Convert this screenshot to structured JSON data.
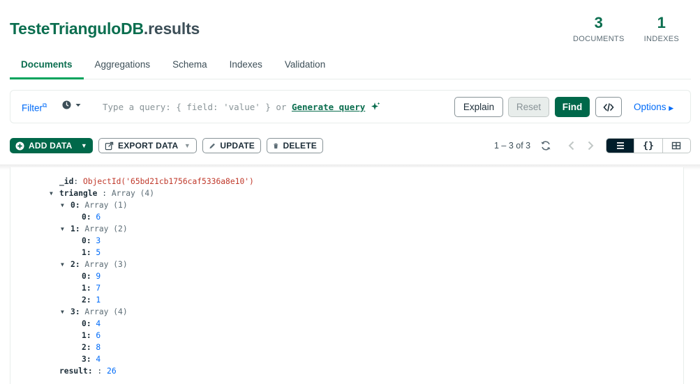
{
  "header": {
    "db_name": "TesteTrianguloDB",
    "collection": ".results",
    "counts": [
      {
        "value": "3",
        "label": "DOCUMENTS"
      },
      {
        "value": "1",
        "label": "INDEXES"
      }
    ]
  },
  "tabs": [
    {
      "label": "Documents",
      "active": true
    },
    {
      "label": "Aggregations"
    },
    {
      "label": "Schema"
    },
    {
      "label": "Indexes"
    },
    {
      "label": "Validation"
    }
  ],
  "querybar": {
    "filter_label": "Filter",
    "query_placeholder": "Type a query: { field: 'value' } or ",
    "generate_label": "Generate query",
    "explain_label": "Explain",
    "reset_label": "Reset",
    "find_label": "Find",
    "options_label": "Options"
  },
  "toolbar": {
    "add_data": "ADD DATA",
    "export_data": "EXPORT DATA",
    "update": "UPDATE",
    "delete": "DELETE",
    "paging": "1 – 3 of 3"
  },
  "colors": {
    "brand_green": "#00684a",
    "link_blue": "#016bf8",
    "objectid_red": "#c0392b"
  },
  "document": {
    "id_key": "_id",
    "id_value": "ObjectId('65bd21cb1756caf5336a8e10')",
    "triangle_key": "triangle",
    "triangle_type": "Array (4)",
    "triangle": [
      {
        "index": "0",
        "type": "Array (1)",
        "items": [
          [
            "0",
            "6"
          ]
        ]
      },
      {
        "index": "1",
        "type": "Array (2)",
        "items": [
          [
            "0",
            "3"
          ],
          [
            "1",
            "5"
          ]
        ]
      },
      {
        "index": "2",
        "type": "Array (3)",
        "items": [
          [
            "0",
            "9"
          ],
          [
            "1",
            "7"
          ],
          [
            "2",
            "1"
          ]
        ]
      },
      {
        "index": "3",
        "type": "Array (4)",
        "items": [
          [
            "0",
            "4"
          ],
          [
            "1",
            "6"
          ],
          [
            "2",
            "8"
          ],
          [
            "3",
            "4"
          ]
        ]
      }
    ],
    "result_key": "result",
    "result_value": "26"
  }
}
